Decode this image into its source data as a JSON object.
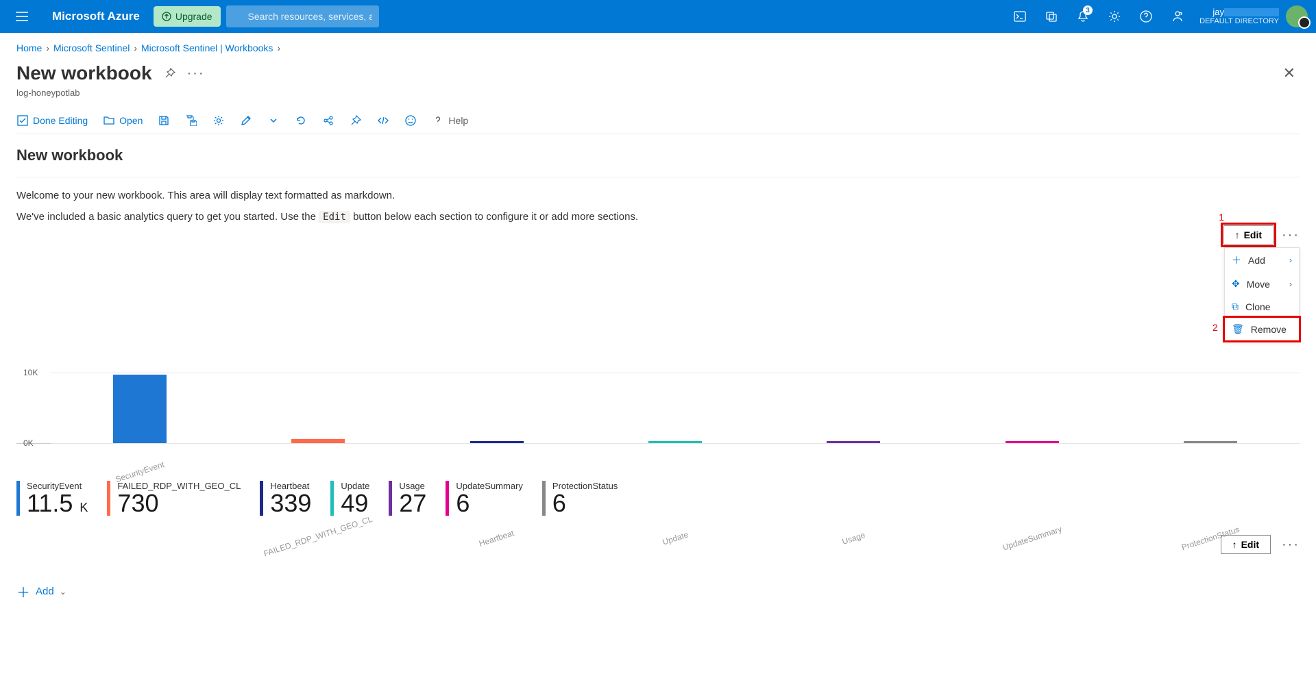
{
  "topbar": {
    "brand": "Microsoft Azure",
    "upgrade": "Upgrade",
    "search_placeholder": "Search resources, services, and docs (G+/)",
    "notification_count": "3",
    "user_name": "jay",
    "user_directory": "DEFAULT DIRECTORY"
  },
  "breadcrumb": {
    "items": [
      "Home",
      "Microsoft Sentinel",
      "Microsoft Sentinel | Workbooks"
    ]
  },
  "header": {
    "title": "New workbook",
    "subtitle": "log-honeypotlab"
  },
  "toolbar": {
    "done_editing": "Done Editing",
    "open": "Open",
    "help": "Help"
  },
  "section": {
    "title": "New workbook",
    "intro_line1": "Welcome to your new workbook. This area will display text formatted as markdown.",
    "intro_line2_pre": "We've included a basic analytics query to get you started. Use the ",
    "intro_line2_code": "Edit",
    "intro_line2_post": " button below each section to configure it or add more sections."
  },
  "edit_button": "Edit",
  "annotations": {
    "one": "1",
    "two": "2"
  },
  "context_menu": {
    "add": "Add",
    "move": "Move",
    "clone": "Clone",
    "remove": "Remove"
  },
  "chart_data": {
    "type": "bar",
    "ylim_label_top": "10K",
    "ylim_label_bottom": "0K",
    "ymax": 12000,
    "series": [
      {
        "name": "SecurityEvent",
        "value": 11500,
        "color": "#1f77d4"
      },
      {
        "name": "FAILED_RDP_WITH_GEO_CL",
        "value": 730,
        "color": "#ff6b4a"
      },
      {
        "name": "Heartbeat",
        "value": 339,
        "color": "#1d2a8c"
      },
      {
        "name": "Update",
        "value": 49,
        "color": "#1fbfb8"
      },
      {
        "name": "Usage",
        "value": 27,
        "color": "#7030a0"
      },
      {
        "name": "UpdateSummary",
        "value": 6,
        "color": "#e3008c"
      },
      {
        "name": "ProtectionStatus",
        "value": 6,
        "color": "#8a8886"
      }
    ]
  },
  "tiles": [
    {
      "label": "SecurityEvent",
      "value": "11.5",
      "unit": "K",
      "color": "#1f77d4"
    },
    {
      "label": "FAILED_RDP_WITH_GEO_CL",
      "value": "730",
      "unit": "",
      "color": "#ff6b4a"
    },
    {
      "label": "Heartbeat",
      "value": "339",
      "unit": "",
      "color": "#1d2a8c"
    },
    {
      "label": "Update",
      "value": "49",
      "unit": "",
      "color": "#1fbfb8"
    },
    {
      "label": "Usage",
      "value": "27",
      "unit": "",
      "color": "#7030a0"
    },
    {
      "label": "UpdateSummary",
      "value": "6",
      "unit": "",
      "color": "#e3008c"
    },
    {
      "label": "ProtectionStatus",
      "value": "6",
      "unit": "",
      "color": "#8a8886"
    }
  ],
  "footer": {
    "add": "Add"
  }
}
